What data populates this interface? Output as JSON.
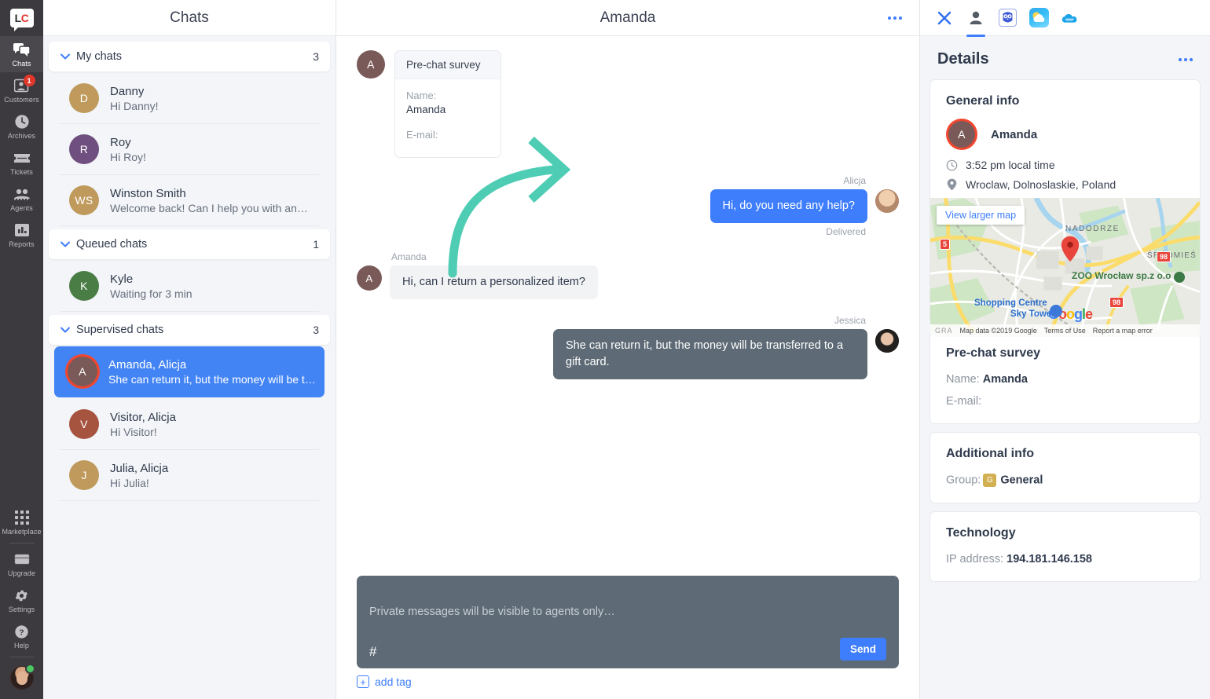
{
  "brand": {
    "logo_text_l": "L",
    "logo_text_c": "C",
    "accent_blue": "#3e7dfb",
    "selected_blue": "#4384f5",
    "rail_bg": "#3c3a3f",
    "private_gray": "#5e6b76",
    "arrow_teal": "#4ecdb4"
  },
  "rail": {
    "items": [
      {
        "label": "Chats",
        "icon": "chats-icon",
        "active": true,
        "badge": ""
      },
      {
        "label": "Customers",
        "icon": "customers-icon",
        "active": false,
        "badge": "1"
      },
      {
        "label": "Archives",
        "icon": "archives-icon",
        "active": false,
        "badge": ""
      },
      {
        "label": "Tickets",
        "icon": "tickets-icon",
        "active": false,
        "badge": ""
      },
      {
        "label": "Agents",
        "icon": "agents-icon",
        "active": false,
        "badge": ""
      },
      {
        "label": "Reports",
        "icon": "reports-icon",
        "active": false,
        "badge": ""
      }
    ],
    "bottom_items": [
      {
        "label": "Marketplace",
        "icon": "marketplace-icon"
      },
      {
        "label": "Upgrade",
        "icon": "upgrade-icon"
      },
      {
        "label": "Settings",
        "icon": "gear-icon"
      },
      {
        "label": "Help",
        "icon": "help-icon"
      }
    ]
  },
  "chatlist": {
    "title": "Chats",
    "groups": [
      {
        "name": "My chats",
        "count": "3",
        "rows": [
          {
            "initials": "D",
            "color": "#bf9a5c",
            "name": "Danny",
            "snippet": "Hi Danny!",
            "selected": false,
            "ring": false
          },
          {
            "initials": "R",
            "color": "#6f4f7f",
            "name": "Roy",
            "snippet": "Hi Roy!",
            "selected": false,
            "ring": false
          },
          {
            "initials": "WS",
            "color": "#bf9a5c",
            "name": "Winston Smith",
            "snippet": "Welcome back! Can I help you with anythi…",
            "selected": false,
            "ring": false
          }
        ]
      },
      {
        "name": "Queued chats",
        "count": "1",
        "rows": [
          {
            "initials": "K",
            "color": "#4a7c46",
            "name": "Kyle",
            "snippet": "Waiting for 3 min",
            "selected": false,
            "ring": false
          }
        ]
      },
      {
        "name": "Supervised chats",
        "count": "3",
        "rows": [
          {
            "initials": "A",
            "color": "#7a5a58",
            "name": "Amanda, Alicja",
            "snippet": "She can return it, but the money will be tr…",
            "selected": true,
            "ring": true
          },
          {
            "initials": "V",
            "color": "#a6543f",
            "name": "Visitor, Alicja",
            "snippet": "Hi Visitor!",
            "selected": false,
            "ring": false
          },
          {
            "initials": "J",
            "color": "#bf9a5c",
            "name": "Julia, Alicja",
            "snippet": "Hi Julia!",
            "selected": false,
            "ring": false
          }
        ]
      }
    ]
  },
  "conversation": {
    "title": "Amanda",
    "menu_icon": "kebab-menu-icon",
    "survey": {
      "avatar_initials": "A",
      "avatar_color": "#7a5a58",
      "heading": "Pre-chat survey",
      "name_label": "Name:",
      "name_value": "Amanda",
      "email_label": "E-mail:",
      "email_value": ""
    },
    "messages": [
      {
        "kind": "agent",
        "author": "Alicja",
        "text": "Hi, do you need any help?",
        "status": "Delivered",
        "avatar": "alicja"
      },
      {
        "kind": "customer",
        "author": "Amanda",
        "text": "Hi, can I return a personalized item?",
        "status": "",
        "avatar_initials": "A",
        "avatar_color": "#7a5a58"
      },
      {
        "kind": "private",
        "author": "Jessica",
        "text": "She can return it, but the money will be transferred to a gift card.",
        "status": "",
        "avatar": "jessica"
      }
    ],
    "composer": {
      "placeholder": "Private messages will be visible to agents only…",
      "value": "",
      "hash_label": "#",
      "send_label": "Send"
    },
    "add_tag": {
      "plus": "+",
      "label": "add tag"
    }
  },
  "details": {
    "apps": [
      {
        "name": "close-icon",
        "title": "Close",
        "active": false
      },
      {
        "name": "person-details-icon",
        "title": "Details",
        "active": true
      },
      {
        "name": "owl-app-icon",
        "title": "Owl app",
        "active": false
      },
      {
        "name": "weather-app-icon",
        "title": "Weather",
        "active": false
      },
      {
        "name": "salesforce-app-icon",
        "title": "Salesforce",
        "active": false
      }
    ],
    "title": "Details",
    "menu_icon": "kebab-menu-icon",
    "general": {
      "card_title": "General info",
      "avatar_initials": "A",
      "avatar_color": "#7a5a58",
      "customer_name": "Amanda",
      "local_time": "3:52 pm local time",
      "location": "Wroclaw, Dolnoslaskie, Poland"
    },
    "map": {
      "view_larger": "View larger map",
      "labels": {
        "nadodrze": "NADODRZE",
        "srodmiescie": "ŚRÓDMIEŚ",
        "zoo": "ZOO Wrocław sp.z o.o",
        "shopping_centre": "Shopping Centre",
        "sky_tower": "Sky Tower",
        "gra": "GRA",
        "shield_5": "5",
        "shield_98a": "98",
        "shield_98b": "98",
        "google": "Google"
      },
      "footer": {
        "map_data": "Map data ©2019 Google",
        "terms": "Terms of Use",
        "report": "Report a map error"
      }
    },
    "prechat": {
      "card_title": "Pre-chat survey",
      "name_label": "Name:",
      "name_value": "Amanda",
      "email_label": "E-mail:",
      "email_value": ""
    },
    "additional": {
      "card_title": "Additional info",
      "group_label": "Group:",
      "group_chip": "G",
      "group_value": "General"
    },
    "technology": {
      "card_title": "Technology",
      "ip_label": "IP address:",
      "ip_value": "194.181.146.158"
    }
  }
}
